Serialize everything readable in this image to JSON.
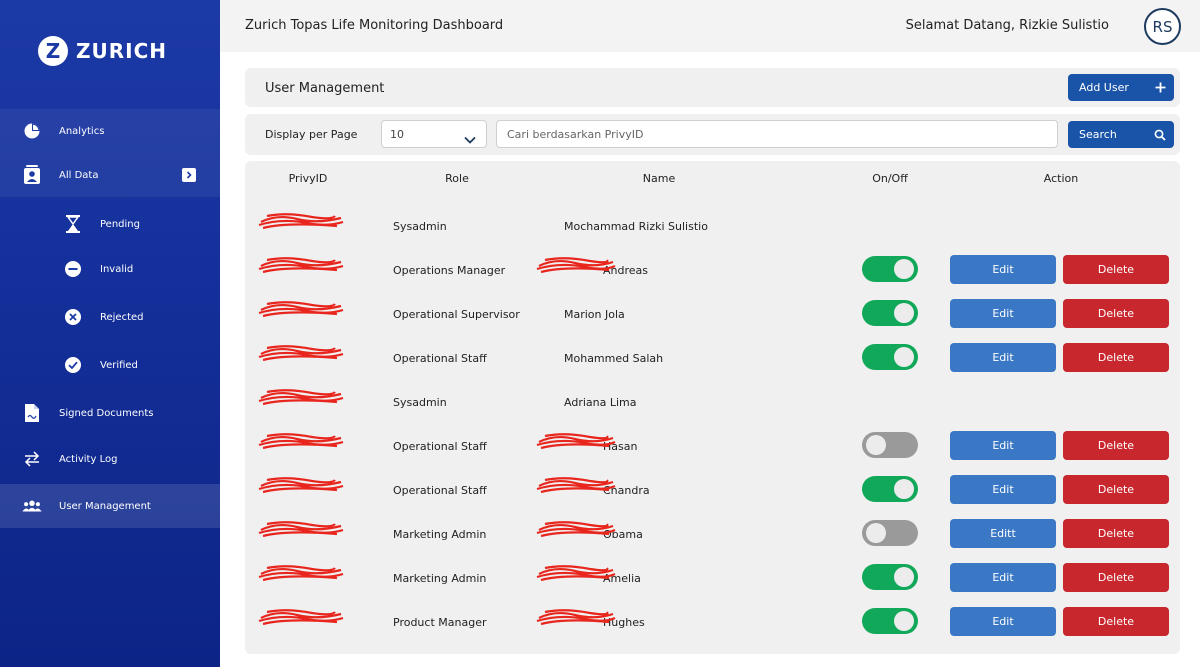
{
  "brand": {
    "name": "ZURICH"
  },
  "header": {
    "title": "Zurich Topas Life Monitoring Dashboard",
    "welcome": "Selamat Datang, Rizkie Sulistio",
    "avatar_initials": "RS"
  },
  "sidebar": {
    "items": [
      {
        "label": "Analytics",
        "icon": "pie-chart-icon"
      },
      {
        "label": "All Data",
        "icon": "user-card-icon"
      },
      {
        "label": "Pending",
        "icon": "hourglass-icon"
      },
      {
        "label": "Invalid",
        "icon": "minus-circle-icon"
      },
      {
        "label": "Rejected",
        "icon": "x-circle-icon"
      },
      {
        "label": "Verified",
        "icon": "check-circle-icon"
      },
      {
        "label": "Signed Documents",
        "icon": "document-icon"
      },
      {
        "label": "Activity Log",
        "icon": "swap-arrows-icon"
      },
      {
        "label": "User Management",
        "icon": "users-icon"
      }
    ],
    "active": "User Management"
  },
  "user_management": {
    "title": "User Management",
    "add_user_label": "Add User",
    "display_per_page_label": "Display per Page",
    "display_per_page_value": "10",
    "search_placeholder": "Cari berdasarkan PrivyID",
    "search_button_label": "Search"
  },
  "table": {
    "columns": [
      "PrivyID",
      "Role",
      "Name",
      "On/Off",
      "Action"
    ],
    "rows": [
      {
        "role": "Sysadmin",
        "name": "Mochammad Rizki Sulistio",
        "name_redacted": false,
        "toggle": null,
        "edit_label": "",
        "delete_label": ""
      },
      {
        "role": "Operations Manager",
        "name": "Andreas",
        "name_redacted": true,
        "toggle": "on",
        "edit_label": "Edit",
        "delete_label": "Delete"
      },
      {
        "role": "Operational Supervisor",
        "name": "Marion Jola",
        "name_redacted": false,
        "toggle": "on",
        "edit_label": "Edit",
        "delete_label": "Delete"
      },
      {
        "role": "Operational Staff",
        "name": "Mohammed Salah",
        "name_redacted": false,
        "toggle": "on",
        "edit_label": "Edit",
        "delete_label": "Delete"
      },
      {
        "role": "Sysadmin",
        "name": "Adriana Lima",
        "name_redacted": false,
        "toggle": null,
        "edit_label": "",
        "delete_label": ""
      },
      {
        "role": "Operational Staff",
        "name": "Hasan",
        "name_redacted": true,
        "toggle": "off",
        "edit_label": "Edit",
        "delete_label": "Delete"
      },
      {
        "role": "Operational Staff",
        "name": "Chandra",
        "name_redacted": true,
        "toggle": "on",
        "edit_label": "Edit",
        "delete_label": "Delete"
      },
      {
        "role": "Marketing Admin",
        "name": "Obama",
        "name_redacted": true,
        "toggle": "off",
        "edit_label": "Editt",
        "delete_label": "Delete"
      },
      {
        "role": "Marketing Admin",
        "name": "Amelia",
        "name_redacted": true,
        "toggle": "on",
        "edit_label": "Edit",
        "delete_label": "Delete"
      },
      {
        "role": "Product Manager",
        "name": "Hughes",
        "name_redacted": true,
        "toggle": "on",
        "edit_label": "Edit",
        "delete_label": "Delete"
      }
    ]
  },
  "colors": {
    "sidebar": "#142f99",
    "primary_button": "#1a54a8",
    "edit_button": "#3a78c6",
    "delete_button": "#c8272e",
    "toggle_on": "#12a85a",
    "toggle_off": "#9a9a9a",
    "redaction": "#e8261e"
  }
}
